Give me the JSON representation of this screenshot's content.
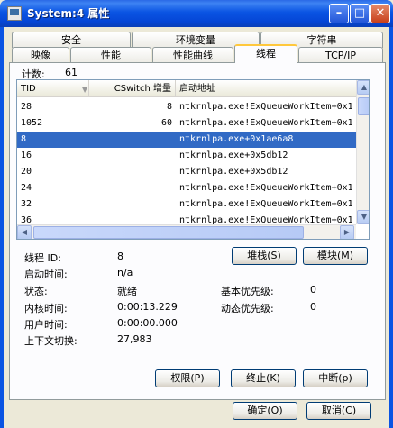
{
  "window": {
    "title": "System:4 属性"
  },
  "tabs_row1": [
    "安全",
    "环境变量",
    "字符串"
  ],
  "tabs_row2": [
    "映像",
    "性能",
    "性能曲线",
    "线程",
    "TCP/IP"
  ],
  "count": {
    "label": "计数:",
    "value": "61"
  },
  "columns": {
    "tid": "TID",
    "cswitch": "CSwitch 增量",
    "start": "启动地址"
  },
  "rows": [
    {
      "tid": "28",
      "cswitch": "8",
      "start": "ntkrnlpa.exe!ExQueueWorkItem+0x1"
    },
    {
      "tid": "1052",
      "cswitch": "60",
      "start": "ntkrnlpa.exe!ExQueueWorkItem+0x1"
    },
    {
      "tid": "8",
      "cswitch": "",
      "start": "ntkrnlpa.exe+0x1ae6a8"
    },
    {
      "tid": "16",
      "cswitch": "",
      "start": "ntkrnlpa.exe+0x5db12"
    },
    {
      "tid": "20",
      "cswitch": "",
      "start": "ntkrnlpa.exe+0x5db12"
    },
    {
      "tid": "24",
      "cswitch": "",
      "start": "ntkrnlpa.exe!ExQueueWorkItem+0x1"
    },
    {
      "tid": "32",
      "cswitch": "",
      "start": "ntkrnlpa.exe!ExQueueWorkItem+0x1"
    },
    {
      "tid": "36",
      "cswitch": "",
      "start": "ntkrnlpa.exe!ExQueueWorkItem+0x1"
    }
  ],
  "details": {
    "thread_id_label": "线程 ID:",
    "thread_id": "8",
    "start_time_label": "启动时间:",
    "start_time": "n/a",
    "state_label": "状态:",
    "state": "就绪",
    "kernel_time_label": "内核时间:",
    "kernel_time": "0:00:13.229",
    "user_time_label": "用户时间:",
    "user_time": "0:00:00.000",
    "ctx_label": "上下文切换:",
    "ctx": "27,983",
    "base_prio_label": "基本优先级:",
    "base_prio": "0",
    "dyn_prio_label": "动态优先级:",
    "dyn_prio": "0"
  },
  "buttons": {
    "stack": "堆栈(S)",
    "module": "模块(M)",
    "perm": "权限(P)",
    "kill": "终止(K)",
    "suspend": "中断(p)",
    "ok": "确定(O)",
    "cancel": "取消(C)"
  }
}
